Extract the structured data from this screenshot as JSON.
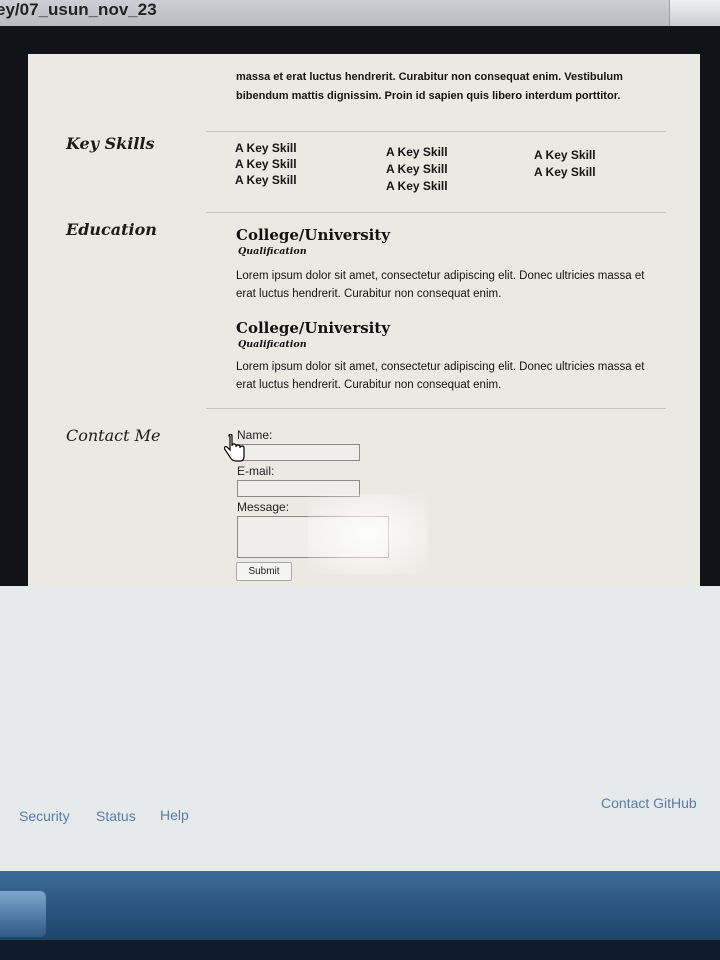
{
  "window": {
    "title": "ey/07_usun_nov_23"
  },
  "resume": {
    "intro_text": "massa et erat luctus hendrerit. Curabitur non consequat enim. Vestibulum bibendum mattis dignissim. Proin id sapien quis libero interdum porttitor.",
    "key_skills": {
      "heading": "Key Skills",
      "columns": [
        [
          "A Key Skill",
          "A Key Skill",
          "A Key Skill"
        ],
        [
          "A Key Skill",
          "A Key Skill",
          "A Key Skill"
        ],
        [
          "A Key Skill",
          "A Key Skill"
        ]
      ]
    },
    "education": {
      "heading": "Education",
      "entries": [
        {
          "school": "College/University",
          "qualification": "Qualification",
          "text": "Lorem ipsum dolor sit amet, consectetur adipiscing elit. Donec ultricies massa et erat luctus hendrerit. Curabitur non consequat enim."
        },
        {
          "school": "College/University",
          "qualification": "Qualification",
          "text": "Lorem ipsum dolor sit amet, consectetur adipiscing elit. Donec ultricies massa et erat luctus hendrerit. Curabitur non consequat enim."
        }
      ]
    },
    "contact": {
      "heading": "Contact Me",
      "name_label": "Name:",
      "email_label": "E-mail:",
      "message_label": "Message:",
      "submit_label": "Submit",
      "name_value": "",
      "email_value": "",
      "message_value": ""
    }
  },
  "footer": {
    "links": [
      "Security",
      "Status",
      "Help"
    ],
    "right_link": "Contact GitHub"
  },
  "colors": {
    "link": "#5a7da8",
    "taskbar": "#2a5680"
  }
}
